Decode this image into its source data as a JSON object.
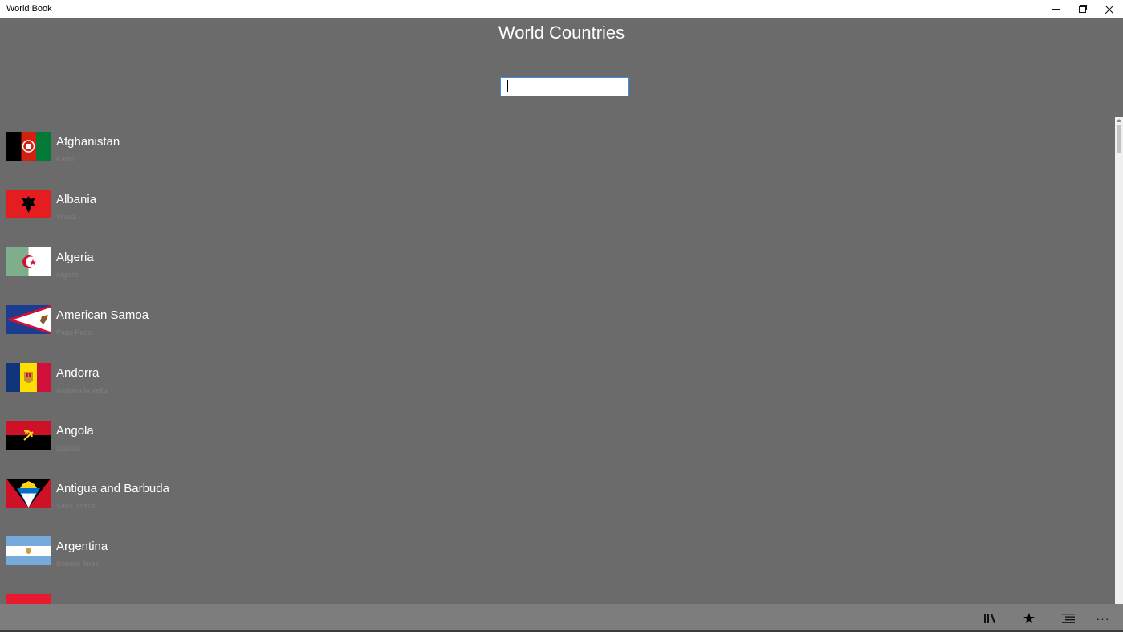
{
  "window": {
    "title": "World Book"
  },
  "page": {
    "heading": "World Countries"
  },
  "search": {
    "value": "",
    "placeholder": ""
  },
  "countries": [
    {
      "name": "Afghanistan",
      "capital": "Kabul",
      "flag_icon": "flag-afghanistan-icon"
    },
    {
      "name": "Albania",
      "capital": "Tirana",
      "flag_icon": "flag-albania-icon"
    },
    {
      "name": "Algeria",
      "capital": "Algiers",
      "flag_icon": "flag-algeria-icon"
    },
    {
      "name": "American Samoa",
      "capital": "Pago Pago",
      "flag_icon": "flag-american-samoa-icon"
    },
    {
      "name": "Andorra",
      "capital": "Andorra la Vella",
      "flag_icon": "flag-andorra-icon"
    },
    {
      "name": "Angola",
      "capital": "Luanda",
      "flag_icon": "flag-angola-icon"
    },
    {
      "name": "Antigua and Barbuda",
      "capital": "Saint John's",
      "flag_icon": "flag-antigua-and-barbuda-icon"
    },
    {
      "name": "Argentina",
      "capital": "Buenos Aires",
      "flag_icon": "flag-argentina-icon"
    },
    {
      "name": "",
      "capital": "",
      "flag_icon": "flag-armenia-icon"
    }
  ],
  "app_bar": {
    "buttons": [
      {
        "icon": "library-icon"
      },
      {
        "icon": "star-icon"
      },
      {
        "icon": "list-icon"
      },
      {
        "icon": "more-icon",
        "label": "···"
      }
    ]
  },
  "colors": {
    "background": "#6b6b6b",
    "app_bar": "#7d7d7d",
    "search_border": "#3b8ee8",
    "capital_text": "#7f7f7f"
  }
}
